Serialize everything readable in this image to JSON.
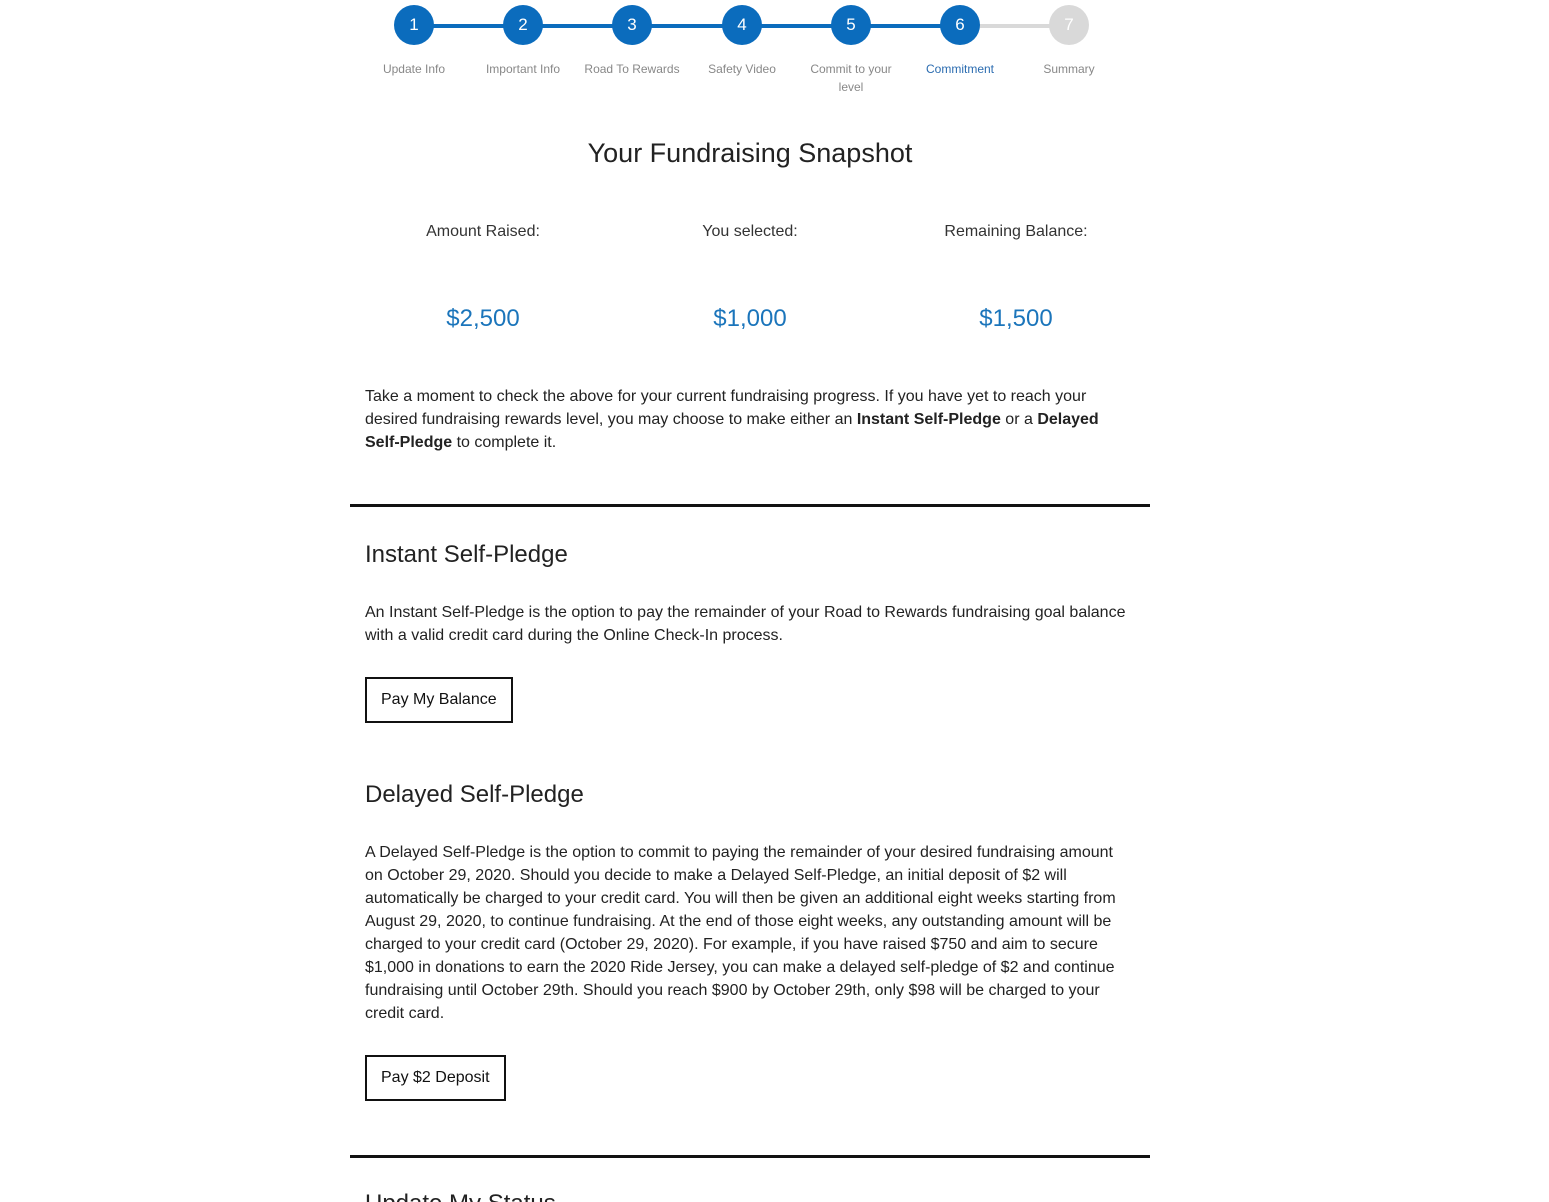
{
  "stepper": {
    "active_color": "#0b6cbd",
    "inactive_color": "#d9d9d9",
    "current_step": 6,
    "steps": [
      {
        "number": "1",
        "label": "Update Info"
      },
      {
        "number": "2",
        "label": "Important Info"
      },
      {
        "number": "3",
        "label": "Road To Rewards"
      },
      {
        "number": "4",
        "label": "Safety Video"
      },
      {
        "number": "5",
        "label": "Commit to your level"
      },
      {
        "number": "6",
        "label": "Commitment"
      },
      {
        "number": "7",
        "label": "Summary"
      }
    ]
  },
  "snapshot": {
    "title": "Your Fundraising Snapshot",
    "stats": [
      {
        "label": "Amount Raised:",
        "value": "$2,500"
      },
      {
        "label": "You selected:",
        "value": "$1,000"
      },
      {
        "label": "Remaining Balance:",
        "value": "$1,500"
      }
    ],
    "value_color": "#1b75bb"
  },
  "intro": {
    "part1": "Take a moment to check the above for your current fundraising progress. If you have yet to reach your desired fundraising rewards level, you may choose to make either an ",
    "bold1": "Instant Self-Pledge",
    "part2": " or a ",
    "bold2": "Delayed Self-Pledge",
    "part3": " to complete it."
  },
  "instant": {
    "title": "Instant Self-Pledge",
    "text": "An Instant Self-Pledge is the option to pay the remainder of your Road to Rewards fundraising goal balance with a valid credit card during the Online Check-In process.",
    "button_label": "Pay My Balance"
  },
  "delayed": {
    "title": "Delayed Self-Pledge",
    "text": "A Delayed Self-Pledge is the option to commit to paying the remainder of your desired fundraising amount on October 29, 2020. Should you decide to make a Delayed Self-Pledge, an initial deposit of $2 will automatically be charged to your credit card. You will then be given an additional eight weeks starting from August 29, 2020, to continue fundraising. At the end of those eight weeks, any outstanding amount will be charged to your credit card (October 29, 2020). For example, if you have raised $750 and aim to secure $1,000 in donations to earn the 2020 Ride Jersey, you can make a delayed self-pledge of $2 and continue fundraising until October 29th. Should you reach $900 by October 29th, only $98 will be charged to your credit card.",
    "button_label": "Pay $2 Deposit"
  },
  "next_section": {
    "title": "Update My Status"
  }
}
